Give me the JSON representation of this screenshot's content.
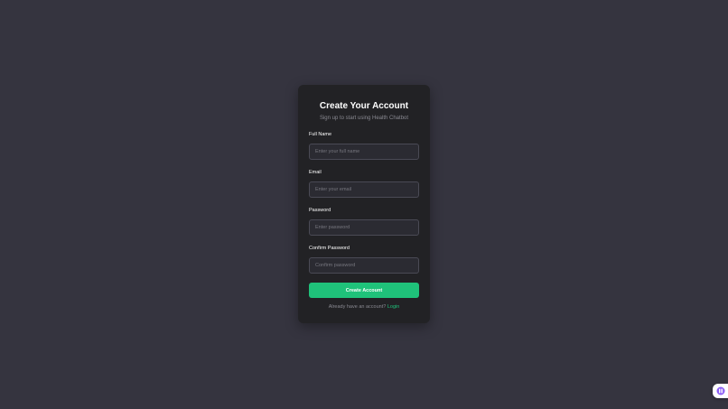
{
  "form": {
    "title": "Create Your Account",
    "subtitle": "Sign up to start using Health Chatbot",
    "fields": [
      {
        "label": "Full Name",
        "placeholder": "Enter your full name",
        "value": ""
      },
      {
        "label": "Email",
        "placeholder": "Enter your email",
        "value": ""
      },
      {
        "label": "Password",
        "placeholder": "Enter password",
        "value": ""
      },
      {
        "label": "Confirm Password",
        "placeholder": "Confirm password",
        "value": ""
      }
    ],
    "submit_label": "Create Account",
    "footer_text": "Already have an account?",
    "login_link": "Login"
  },
  "colors": {
    "background": "#35343f",
    "card": "#222225",
    "accent": "#1fc27a",
    "widget_icon": "#8b5cf6"
  },
  "widget": {
    "icon": "chat-widget-icon"
  }
}
